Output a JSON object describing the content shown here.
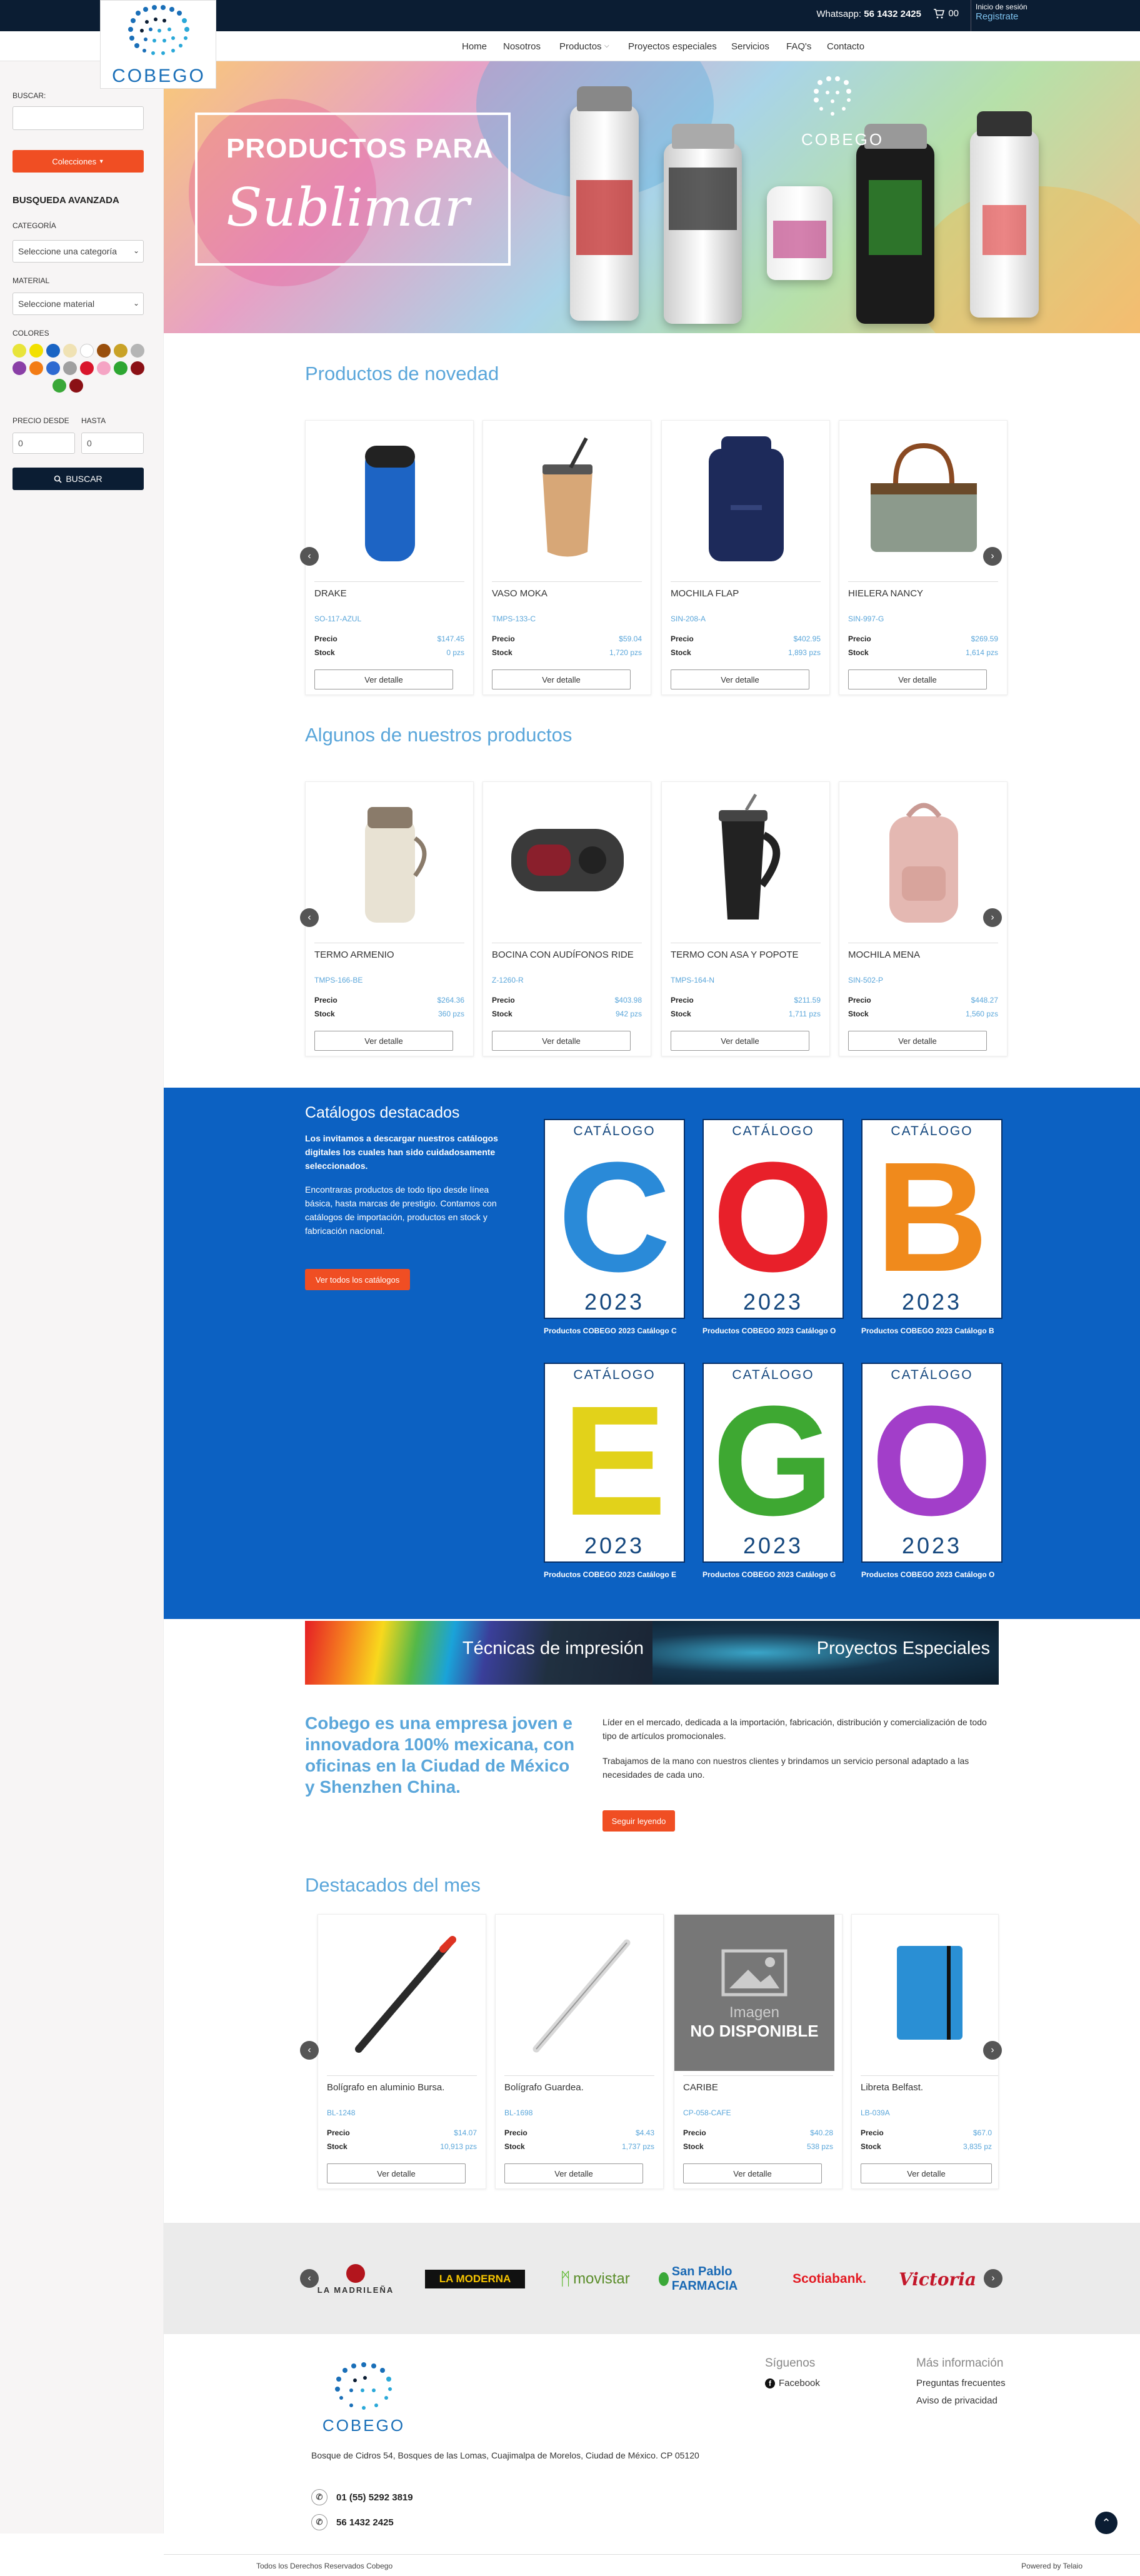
{
  "topbar": {
    "whatsapp_label": "Whatsapp:",
    "whatsapp_number": "56 1432 2425",
    "cart_count": "00",
    "login_label": "Inicio de sesión",
    "register_label": "Registrate"
  },
  "brand": {
    "logo_text": "COBEGO"
  },
  "nav": {
    "items": [
      "Home",
      "Nosotros",
      "Productos",
      "Proyectos especiales",
      "Servicios",
      "FAQ's",
      "Contacto"
    ]
  },
  "sidebar": {
    "search_label": "BUSCAR:",
    "collections_button": "Colecciones",
    "advanced_heading": "BUSQUEDA AVANZADA",
    "category_label": "CATEGORÍA",
    "category_value": "Seleccione una categoría",
    "material_label": "MATERIAL",
    "material_value": "Seleccione material",
    "colors_label": "COLORES",
    "colors": [
      "#e8e43a",
      "#f2e000",
      "#1a64c4",
      "#f0e2b4",
      "#ffffff",
      "#9a4f0c",
      "#c9a227",
      "#b5b5b5",
      "#8a3fa6",
      "#f37c14",
      "#2e6ad1",
      "#a0a0a0",
      "#d9152b",
      "#f5a4c4",
      "#2da631",
      "#8b1015"
    ],
    "price_from_label": "PRECIO DESDE",
    "price_to_label": "HASTA",
    "price_from": "0",
    "price_to": "0",
    "search_button": "BUSCAR"
  },
  "hero": {
    "line1": "PRODUCTOS PARA",
    "line2": "Sublimar",
    "logo": "COBEGO"
  },
  "novedad": {
    "title": "Productos de novedad",
    "products": [
      {
        "name": "DRAKE",
        "sku": "SO-117-AZUL",
        "price": "$147.45",
        "stock": "0 pzs"
      },
      {
        "name": "VASO MOKA",
        "sku": "TMPS-133-C",
        "price": "$59.04",
        "stock": "1,720 pzs"
      },
      {
        "name": "MOCHILA FLAP",
        "sku": "SIN-208-A",
        "price": "$402.95",
        "stock": "1,893 pzs"
      },
      {
        "name": "HIELERA NANCY",
        "sku": "SIN-997-G",
        "price": "$269.59",
        "stock": "1,614 pzs"
      }
    ]
  },
  "algunos": {
    "title": "Algunos de nuestros productos",
    "products": [
      {
        "name": "TERMO ARMENIO",
        "sku": "TMPS-166-BE",
        "price": "$264.36",
        "stock": "360 pzs"
      },
      {
        "name": "BOCINA CON AUDÍFONOS RIDE",
        "sku": "Z-1260-R",
        "price": "$403.98",
        "stock": "942 pzs"
      },
      {
        "name": "TERMO CON ASA Y POPOTE",
        "sku": "TMPS-164-N",
        "price": "$211.59",
        "stock": "1,711 pzs"
      },
      {
        "name": "MOCHILA MENA",
        "sku": "SIN-502-P",
        "price": "$448.27",
        "stock": "1,560 pzs"
      }
    ]
  },
  "labels": {
    "price": "Precio",
    "stock": "Stock",
    "detail_button": "Ver detalle"
  },
  "catalogs": {
    "title": "Catálogos destacados",
    "intro": "Los invitamos a descargar nuestros catálogos digitales los cuales han sido cuidadosamente seleccionados.",
    "text": "Encontraras productos de todo tipo desde línea básica, hasta marcas de prestigio. Contamos con catálogos de importación, productos en stock y fabricación nacional.",
    "button": "Ver todos los catálogos",
    "cover_title": "CATÁLOGO",
    "year": "2023",
    "items": [
      {
        "letter": "C",
        "color": "#2a8ad8",
        "caption": "Productos COBEGO 2023 Catálogo C"
      },
      {
        "letter": "O",
        "color": "#e8202a",
        "caption": "Productos COBEGO 2023 Catálogo O"
      },
      {
        "letter": "B",
        "color": "#f08a1c",
        "caption": "Productos COBEGO 2023 Catálogo B"
      },
      {
        "letter": "E",
        "color": "#e2d21a",
        "caption": "Productos COBEGO 2023 Catálogo E"
      },
      {
        "letter": "G",
        "color": "#3ea832",
        "caption": "Productos COBEGO 2023 Catálogo G"
      },
      {
        "letter": "O",
        "color": "#a23ec9",
        "caption": "Productos COBEGO 2023 Catálogo O"
      }
    ]
  },
  "banners": {
    "left": "Técnicas de impresión",
    "right": "Proyectos Especiales"
  },
  "about": {
    "heading": "Cobego es una empresa joven e innovadora 100% mexicana, con oficinas en la Ciudad de México y Shenzhen China.",
    "p1": "Líder en el mercado, dedicada a la importación, fabricación, distribución y comercialización de todo tipo de artículos promocionales.",
    "p2": "Trabajamos de la mano con nuestros clientes y brindamos un servicio personal adaptado a las necesidades de cada uno.",
    "button": "Seguir leyendo"
  },
  "destacados": {
    "title": "Destacados del mes",
    "placeholder_line1": "Imagen",
    "placeholder_line2": "NO DISPONIBLE",
    "products": [
      {
        "name": "Bolígrafo en aluminio Bursa.",
        "sku": "BL-1248",
        "price": "$14.07",
        "stock": "10,913 pzs"
      },
      {
        "name": "Bolígrafo Guardea.",
        "sku": "BL-1698",
        "price": "$4.43",
        "stock": "1,737 pzs"
      },
      {
        "name": "CARIBE",
        "sku": "CP-058-CAFE",
        "price": "$40.28",
        "stock": "538 pzs"
      },
      {
        "name": "Libreta Belfast.",
        "sku": "LB-039A",
        "price": "$67.0",
        "stock": "3,835 pz"
      }
    ]
  },
  "brands": [
    "LA MADRILEÑA",
    "LA MODERNA",
    "movistar",
    "San Pablo FARMACIA",
    "Scotiabank.",
    "Victoria"
  ],
  "footer": {
    "address": "Bosque de Cidros 54, Bosques de las Lomas, Cuajimalpa de Morelos, Ciudad de México. CP 05120",
    "phone": "01 (55) 5292 3819",
    "whatsapp": "56 1432 2425",
    "follow_head": "Síguenos",
    "facebook": "Facebook",
    "more_head": "Más información",
    "faq": "Preguntas frecuentes",
    "privacy": "Aviso de privacidad",
    "rights": "Todos los Derechos Reservados Cobego",
    "powered": "Powered by Telaio"
  }
}
